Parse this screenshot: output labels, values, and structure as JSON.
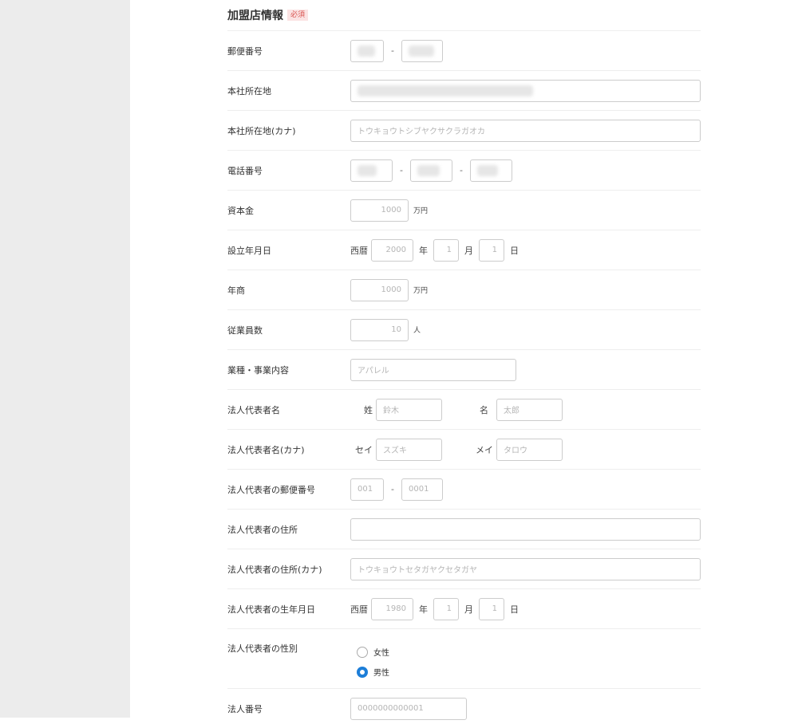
{
  "section": {
    "title": "加盟店情報",
    "required_badge": "必須"
  },
  "fields": {
    "postal": {
      "label": "郵便番号",
      "separator": "-"
    },
    "address": {
      "label": "本社所在地"
    },
    "address_kana": {
      "label": "本社所在地(カナ)",
      "placeholder": "トウキョウトシブヤクサクラガオカ"
    },
    "phone": {
      "label": "電話番号",
      "separator": "-"
    },
    "capital": {
      "label": "資本金",
      "placeholder": "1000",
      "unit": "万円"
    },
    "founded": {
      "label": "設立年月日",
      "era": "西暦",
      "year": "2000",
      "year_unit": "年",
      "month": "1",
      "month_unit": "月",
      "day": "1",
      "day_unit": "日"
    },
    "annual_sales": {
      "label": "年商",
      "placeholder": "1000",
      "unit": "万円"
    },
    "employees": {
      "label": "従業員数",
      "placeholder": "10",
      "unit": "人"
    },
    "business": {
      "label": "業種・事業内容",
      "placeholder": "アパレル"
    },
    "rep_name": {
      "label": "法人代表者名",
      "last_label": "姓",
      "last_placeholder": "鈴木",
      "first_label": "名",
      "first_placeholder": "太郎"
    },
    "rep_name_kana": {
      "label": "法人代表者名(カナ)",
      "last_label": "セイ",
      "last_placeholder": "スズキ",
      "first_label": "メイ",
      "first_placeholder": "タロウ"
    },
    "rep_postal": {
      "label": "法人代表者の郵便番号",
      "placeholder1": "001",
      "separator": "-",
      "placeholder2": "0001"
    },
    "rep_address": {
      "label": "法人代表者の住所"
    },
    "rep_address_kana": {
      "label": "法人代表者の住所(カナ)",
      "placeholder": "トウキョウトセタガヤクセタガヤ"
    },
    "rep_birth": {
      "label": "法人代表者の生年月日",
      "era": "西暦",
      "year": "1980",
      "year_unit": "年",
      "month": "1",
      "month_unit": "月",
      "day": "1",
      "day_unit": "日"
    },
    "rep_gender": {
      "label": "法人代表者の性別",
      "options": [
        "女性",
        "男性"
      ],
      "selected": "男性"
    },
    "corp_number": {
      "label": "法人番号",
      "placeholder": "0000000000001"
    }
  }
}
